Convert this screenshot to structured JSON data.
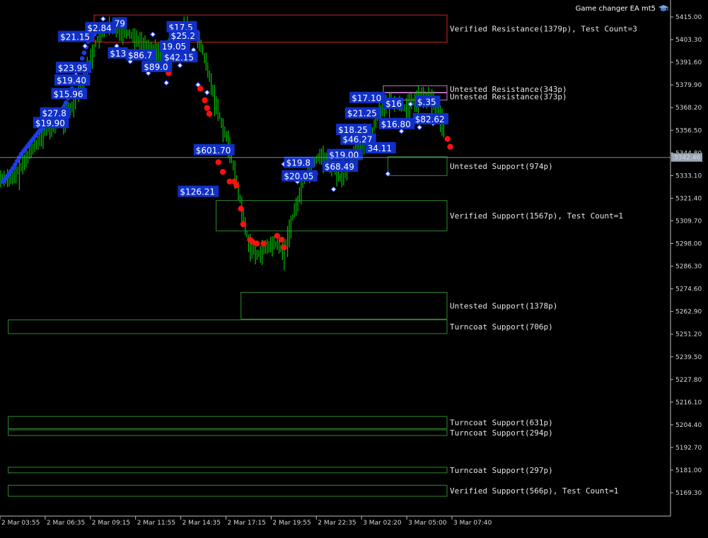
{
  "window": {
    "ea_name": "Game changer EA mt5",
    "hat_icon": "graduation-cap-icon"
  },
  "colors": {
    "background": "#000000",
    "candle": "#00c000",
    "resistance_verified": "#d42020",
    "resistance_untested": "#c878c8",
    "support": "#2f8a2f",
    "buy_marker": "#1c3cf0",
    "sell_marker": "#ff1010",
    "label_bg": "#1030c8",
    "current_line": "#7a8aa0"
  },
  "current_price": "5342.46",
  "chart_data": {
    "type": "candlestick",
    "symbol_panel": "Game changer EA mt5",
    "y_ticks": [
      "5415.00",
      "5403.30",
      "5391.60",
      "5379.90",
      "5368.20",
      "5356.50",
      "5344.80",
      "5333.10",
      "5321.40",
      "5309.70",
      "5298.00",
      "5286.30",
      "5274.60",
      "5262.90",
      "5251.20",
      "5239.50",
      "5227.80",
      "5216.10",
      "5204.40",
      "5192.70",
      "5181.00",
      "5169.30"
    ],
    "ylim": [
      5159.9,
      5420.7
    ],
    "x_ticks": [
      "2 Mar 03:55",
      "2 Mar 06:35",
      "2 Mar 09:15",
      "2 Mar 11:55",
      "2 Mar 14:35",
      "2 Mar 17:15",
      "2 Mar 19:55",
      "2 Mar 22:35",
      "3 Mar 02:20",
      "3 Mar 05:00",
      "3 Mar 07:40"
    ],
    "price_path": [
      [
        0,
        5332
      ],
      [
        0.2,
        5338
      ],
      [
        0.4,
        5346
      ],
      [
        0.6,
        5352
      ],
      [
        0.8,
        5358
      ],
      [
        1.0,
        5362
      ],
      [
        1.3,
        5368
      ],
      [
        1.5,
        5378
      ],
      [
        1.7,
        5392
      ],
      [
        1.9,
        5405
      ],
      [
        2.1,
        5410
      ],
      [
        2.4,
        5408
      ],
      [
        2.7,
        5405
      ],
      [
        3.0,
        5398
      ],
      [
        3.3,
        5396
      ],
      [
        3.6,
        5402
      ],
      [
        3.8,
        5410
      ],
      [
        4.0,
        5408
      ],
      [
        4.2,
        5398
      ],
      [
        4.4,
        5380
      ],
      [
        4.6,
        5362
      ],
      [
        4.8,
        5348
      ],
      [
        5.0,
        5325
      ],
      [
        5.2,
        5300
      ],
      [
        5.4,
        5292
      ],
      [
        5.6,
        5296
      ],
      [
        5.8,
        5298
      ],
      [
        6.0,
        5294
      ],
      [
        6.2,
        5312
      ],
      [
        6.5,
        5334
      ],
      [
        6.8,
        5344
      ],
      [
        7.1,
        5338
      ],
      [
        7.3,
        5330
      ],
      [
        7.6,
        5348
      ],
      [
        7.9,
        5352
      ],
      [
        8.1,
        5366
      ],
      [
        8.4,
        5372
      ],
      [
        8.7,
        5368
      ],
      [
        9.0,
        5374
      ],
      [
        9.3,
        5372
      ],
      [
        9.5,
        5362
      ],
      [
        9.7,
        5347
      ],
      [
        9.75,
        5333
      ],
      [
        9.8,
        5342.46
      ]
    ],
    "zones": [
      {
        "label": "Verified Resistance(1379p), Test Count=3",
        "kind": "resistance_verified",
        "top": 5416.0,
        "bottom": 5402.0,
        "start": 1.8
      },
      {
        "label": "Untested Resistance(343p)",
        "kind": "resistance_untested",
        "top": 5379.5,
        "bottom": 5376.1,
        "start": 8.2
      },
      {
        "label": "Untested Resistance(373p)",
        "kind": "resistance_untested",
        "top": 5375.8,
        "bottom": 5372.1,
        "start": 8.2
      },
      {
        "label": "Untested Support(974p)",
        "kind": "support",
        "top": 5342.8,
        "bottom": 5333.1,
        "start": 8.3
      },
      {
        "label": "Verified Support(1567p), Test Count=1",
        "kind": "support",
        "top": 5320.2,
        "bottom": 5304.5,
        "start": 4.5
      },
      {
        "label": "Untested Support(1378p)",
        "kind": "support",
        "top": 5272.8,
        "bottom": 5259.0,
        "start": 5.05
      },
      {
        "label": "Turncoat Support(706p)",
        "kind": "support",
        "top": 5258.6,
        "bottom": 5251.5,
        "start": -0.1
      },
      {
        "label": "Turncoat Support(631p)",
        "kind": "support",
        "top": 5208.7,
        "bottom": 5202.4,
        "start": -0.1
      },
      {
        "label": "Turncoat Support(294p)",
        "kind": "support",
        "top": 5201.8,
        "bottom": 5198.9,
        "start": -0.1
      },
      {
        "label": "Turncoat Support(297p)",
        "kind": "support",
        "top": 5182.5,
        "bottom": 5179.6,
        "start": -0.1
      },
      {
        "label": "Verified Support(566p), Test Count=1",
        "kind": "support",
        "top": 5173.2,
        "bottom": 5167.5,
        "start": -0.1
      }
    ],
    "trade_labels": [
      {
        "text": "$21.15",
        "x": 1.05,
        "y": 5403.5
      },
      {
        "text": "$23.95",
        "x": 1.0,
        "y": 5387.5
      },
      {
        "text": "$19.40",
        "x": 0.97,
        "y": 5381.0
      },
      {
        "text": "$15.96",
        "x": 0.9,
        "y": 5374.0
      },
      {
        "text": "$27.8",
        "x": 0.65,
        "y": 5364.0
      },
      {
        "text": "$19.90",
        "x": 0.5,
        "y": 5359.0
      },
      {
        "text": "$2.84",
        "x": 1.65,
        "y": 5408.0
      },
      {
        "text": "79",
        "x": 2.25,
        "y": 5410.5
      },
      {
        "text": "$13",
        "x": 2.15,
        "y": 5395.0
      },
      {
        "text": "$86.7",
        "x": 2.55,
        "y": 5394.0
      },
      {
        "text": "$89.0",
        "x": 2.9,
        "y": 5388.0
      },
      {
        "text": "$17.5",
        "x": 3.45,
        "y": 5408.5
      },
      {
        "text": "$25.2",
        "x": 3.5,
        "y": 5404.0
      },
      {
        "text": "19.05",
        "x": 3.3,
        "y": 5398.5
      },
      {
        "text": "$42.15",
        "x": 3.35,
        "y": 5393.0
      },
      {
        "text": "$601.70",
        "x": 4.05,
        "y": 5345.0
      },
      {
        "text": "$126.21",
        "x": 3.7,
        "y": 5323.5
      },
      {
        "text": "$19.8",
        "x": 6.05,
        "y": 5338.5
      },
      {
        "text": "$20.05",
        "x": 6.0,
        "y": 5331.5
      },
      {
        "text": "$68.49",
        "x": 6.9,
        "y": 5336.5
      },
      {
        "text": "$19.00",
        "x": 7.0,
        "y": 5342.5
      },
      {
        "text": "$18.25",
        "x": 7.2,
        "y": 5355.5
      },
      {
        "text": "$46.27",
        "x": 7.3,
        "y": 5350.5
      },
      {
        "text": "$21.25",
        "x": 7.4,
        "y": 5364.0
      },
      {
        "text": "$17.10",
        "x": 7.5,
        "y": 5372.0
      },
      {
        "text": "$16.80",
        "x": 8.15,
        "y": 5358.5
      },
      {
        "text": "34.11",
        "x": 7.85,
        "y": 5346.0
      },
      {
        "text": "$16",
        "x": 8.25,
        "y": 5369.0
      },
      {
        "text": "$.35",
        "x": 8.95,
        "y": 5370.0
      },
      {
        "text": "$82.62",
        "x": 8.9,
        "y": 5361.0
      }
    ]
  }
}
